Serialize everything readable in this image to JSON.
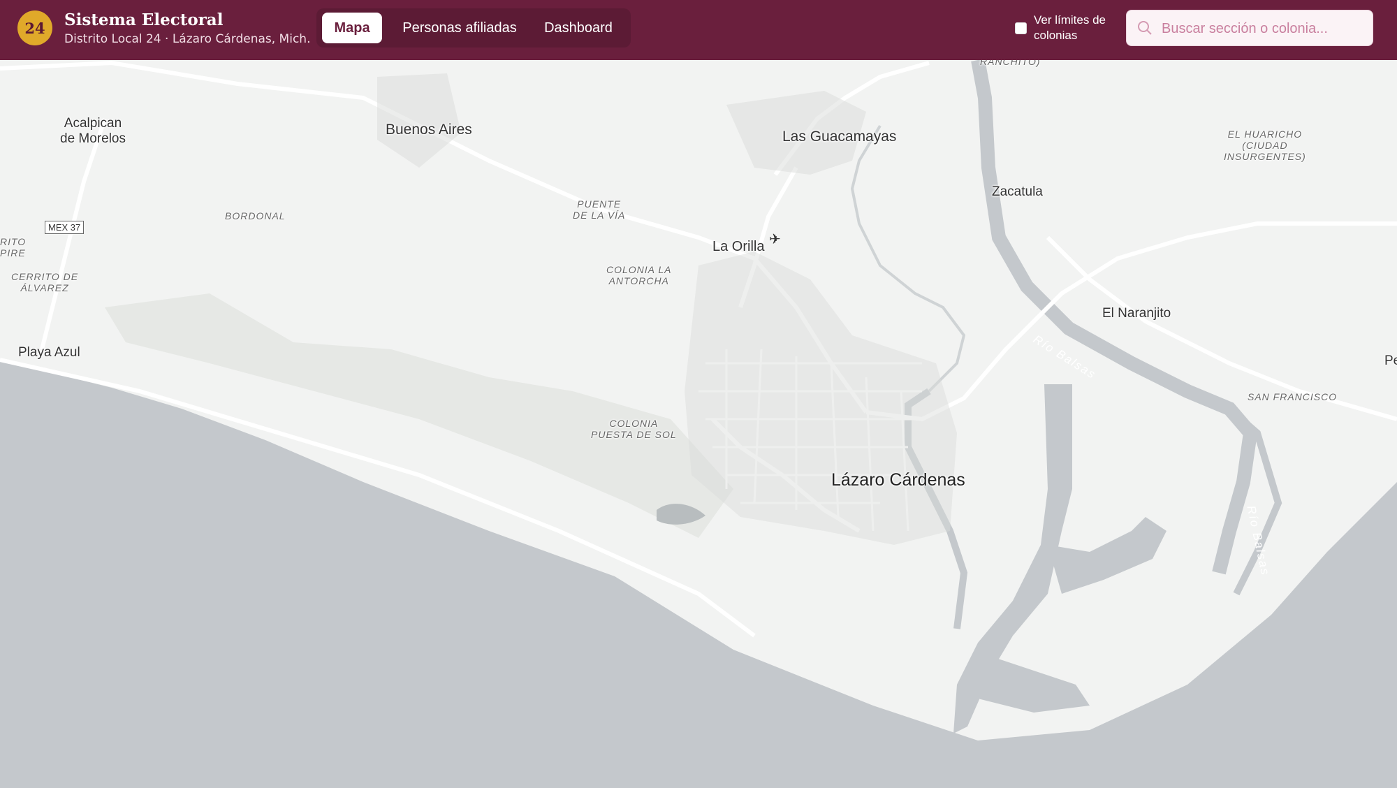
{
  "header": {
    "badge": "24",
    "title": "Sistema Electoral",
    "subtitle": "Distrito Local 24 · Lázaro Cárdenas, Mich.",
    "tabs": [
      {
        "label": "Mapa",
        "active": true
      },
      {
        "label": "Personas afiliadas",
        "active": false
      },
      {
        "label": "Dashboard",
        "active": false
      }
    ],
    "limits_toggle": {
      "label": "Ver límites de colonias",
      "checked": false
    },
    "search": {
      "placeholder": "Buscar sección o colonia...",
      "value": ""
    }
  },
  "map": {
    "route_shield": "MEX 37",
    "labels": {
      "acalpican": "Acalpican\nde Morelos",
      "buenos_aires": "Buenos Aires",
      "las_guacamayas": "Las Guacamayas",
      "ranchito": "RANCHITO)",
      "zacatula": "Zacatula",
      "el_huaricho": "EL HUARICHO\n(CIUDAD\nINSURGENTES)",
      "bordonal": "BORDONAL",
      "puente_via": "PUENTE\nDE LA VÍA",
      "la_orilla": "La Orilla",
      "colonia_antorcha": "COLONIA LA\nANTORCHA",
      "rito": "RITO\nPIRE",
      "cerrito": "CERRITO DE\nÁLVAREZ",
      "playa_azul": "Playa Azul",
      "el_naranjito": "El Naranjito",
      "rio_balsas_1": "Río Balsas",
      "rio_balsas_2": "Río Balsas",
      "san_francisco": "SAN FRANCISCO",
      "pe": "Pe",
      "colonia_puesta": "COLONIA\nPUESTA DE SOL",
      "lazaro_cardenas": "Lázaro Cárdenas"
    }
  },
  "colors": {
    "header_bg": "#6a1f3d",
    "accent": "#e0a92a",
    "land": "#f2f3f2",
    "water": "#c4c8cc",
    "road": "#ffffff"
  }
}
